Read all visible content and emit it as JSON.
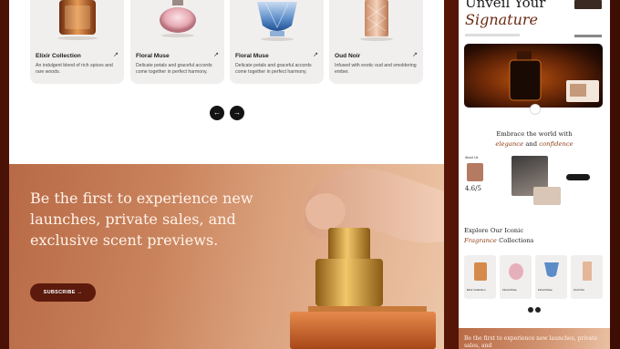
{
  "products": [
    {
      "name": "Elixir Collection",
      "description": "An indulgent blend of rich spices and rare woods."
    },
    {
      "name": "Floral Muse",
      "description": "Delicate petals and graceful accords come together in perfect harmony."
    },
    {
      "name": "Floral Muse",
      "description": "Delicate petals and graceful accords come together in perfect harmony."
    },
    {
      "name": "Oud Noir",
      "description": "Infused with exotic oud and smoldering ember."
    }
  ],
  "arrow_icon": "↗",
  "carousel": {
    "prev": "←",
    "next": "→"
  },
  "banner": {
    "headline": "Be the first to experience new launches, private sales, and exclusive scent previews.",
    "subscribe_label": "SUBSCRIBE",
    "subscribe_arrow": "→"
  },
  "preview": {
    "hero_title": "Unveil Your",
    "hero_subtitle": "Signature",
    "embrace_prefix": "Embrace the world with",
    "embrace_em1": "elegance",
    "embrace_and": "and",
    "embrace_em2": "confidence",
    "about_label": "About Us",
    "rating": "4.6/5",
    "explore_line1": "Explore Our Iconic",
    "explore_em": "Fragrance",
    "explore_rest": "Collections",
    "mini_products": [
      "Elixir Collection",
      "Floral Muse",
      "Floral Muse",
      "Oud Noir"
    ],
    "banner_text": "Be the first to experience new launches, private sales, and"
  },
  "colors": {
    "accent_dark": "#5b1a0c",
    "banner_gradient_start": "#b86a46",
    "banner_gradient_end": "#ecc6a8",
    "card_bg": "#f1efee"
  }
}
